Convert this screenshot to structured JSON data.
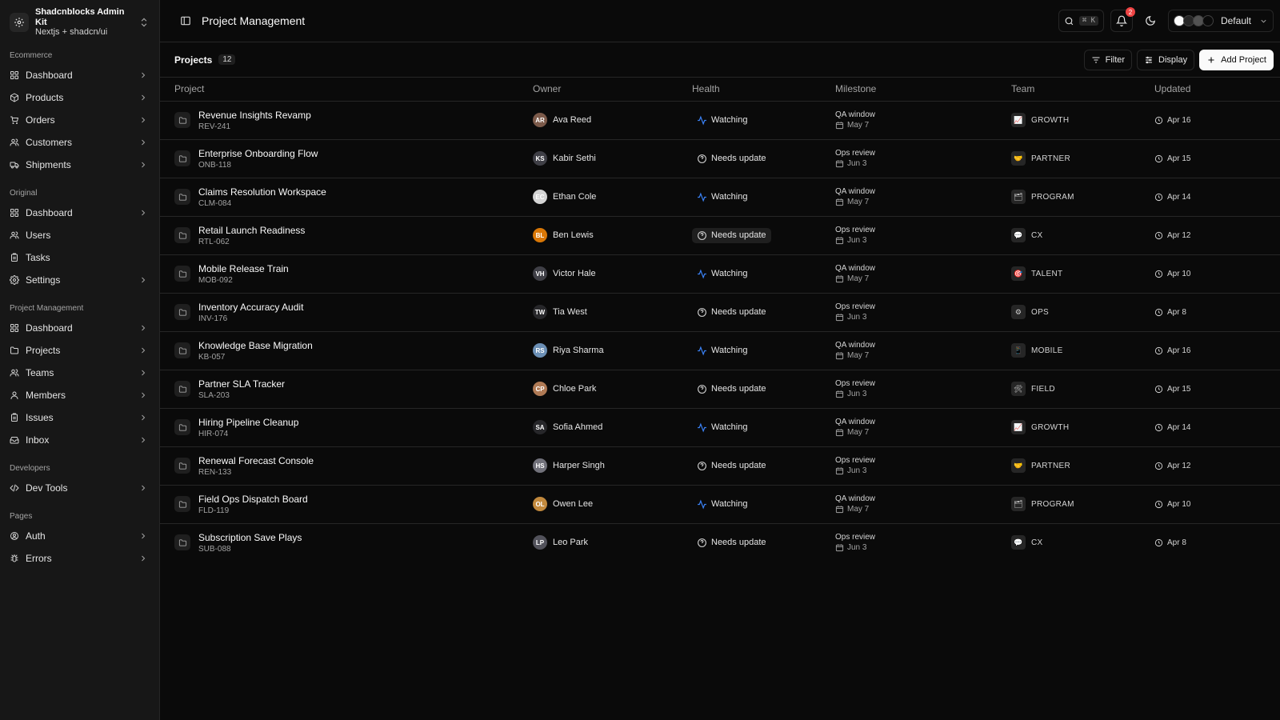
{
  "brand": {
    "name": "Shadcnblocks Admin Kit",
    "sub": "Nextjs + shadcn/ui"
  },
  "sidebar": {
    "groups": [
      {
        "label": "Ecommerce",
        "items": [
          {
            "label": "Dashboard",
            "icon": "dashboard-icon",
            "chevron": true
          },
          {
            "label": "Products",
            "icon": "package-icon",
            "chevron": true
          },
          {
            "label": "Orders",
            "icon": "cart-icon",
            "chevron": true
          },
          {
            "label": "Customers",
            "icon": "users-icon",
            "chevron": true
          },
          {
            "label": "Shipments",
            "icon": "truck-icon",
            "chevron": true
          }
        ]
      },
      {
        "label": "Original",
        "items": [
          {
            "label": "Dashboard",
            "icon": "dashboard-icon",
            "chevron": true
          },
          {
            "label": "Users",
            "icon": "users-icon",
            "chevron": false
          },
          {
            "label": "Tasks",
            "icon": "clipboard-icon",
            "chevron": false
          },
          {
            "label": "Settings",
            "icon": "gear-icon",
            "chevron": true
          }
        ]
      },
      {
        "label": "Project Management",
        "items": [
          {
            "label": "Dashboard",
            "icon": "dashboard-icon",
            "chevron": true
          },
          {
            "label": "Projects",
            "icon": "folder-icon",
            "chevron": true
          },
          {
            "label": "Teams",
            "icon": "users-icon",
            "chevron": true
          },
          {
            "label": "Members",
            "icon": "user-icon",
            "chevron": true
          },
          {
            "label": "Issues",
            "icon": "clipboard-icon",
            "chevron": true
          },
          {
            "label": "Inbox",
            "icon": "inbox-icon",
            "chevron": true
          }
        ]
      },
      {
        "label": "Developers",
        "items": [
          {
            "label": "Dev Tools",
            "icon": "code-icon",
            "chevron": true
          }
        ]
      },
      {
        "label": "Pages",
        "items": [
          {
            "label": "Auth",
            "icon": "auth-icon",
            "chevron": true
          },
          {
            "label": "Errors",
            "icon": "bug-icon",
            "chevron": true
          }
        ]
      }
    ]
  },
  "header": {
    "title": "Project Management",
    "search_kbd": "⌘ K",
    "notifications_count": "2",
    "theme_label": "Default"
  },
  "toolbar": {
    "title": "Projects",
    "count": "12",
    "filter_label": "Filter",
    "display_label": "Display",
    "add_label": "Add Project"
  },
  "columns": [
    "Project",
    "Owner",
    "Health",
    "Milestone",
    "Team",
    "Updated"
  ],
  "rows": [
    {
      "name": "Revenue Insights Revamp",
      "code": "REV-241",
      "owner": "Ava Reed",
      "avatar_color": "#7c5a4a",
      "health": "Watching",
      "milestone": "QA window",
      "due": "May 7",
      "team": "GROWTH",
      "team_icon": "📈",
      "updated": "Apr 16"
    },
    {
      "name": "Enterprise Onboarding Flow",
      "code": "ONB-118",
      "owner": "Kabir Sethi",
      "avatar_color": "#3f3f46",
      "health": "Needs update",
      "milestone": "Ops review",
      "due": "Jun 3",
      "team": "PARTNER",
      "team_icon": "🤝",
      "updated": "Apr 15"
    },
    {
      "name": "Claims Resolution Workspace",
      "code": "CLM-084",
      "owner": "Ethan Cole",
      "avatar_color": "#d4d4d4",
      "health": "Watching",
      "milestone": "QA window",
      "due": "May 7",
      "team": "PROGRAM",
      "team_icon": "🗂",
      "updated": "Apr 14"
    },
    {
      "name": "Retail Launch Readiness",
      "code": "RTL-062",
      "owner": "Ben Lewis",
      "avatar_color": "#d97706",
      "health": "Needs update",
      "milestone": "Ops review",
      "due": "Jun 3",
      "team": "CX",
      "team_icon": "💬",
      "updated": "Apr 12",
      "highlight": true
    },
    {
      "name": "Mobile Release Train",
      "code": "MOB-092",
      "owner": "Victor Hale",
      "avatar_color": "#3f3f46",
      "health": "Watching",
      "milestone": "QA window",
      "due": "May 7",
      "team": "TALENT",
      "team_icon": "🎯",
      "updated": "Apr 10"
    },
    {
      "name": "Inventory Accuracy Audit",
      "code": "INV-176",
      "owner": "Tia West",
      "avatar_color": "#27272a",
      "health": "Needs update",
      "milestone": "Ops review",
      "due": "Jun 3",
      "team": "OPS",
      "team_icon": "⚙",
      "updated": "Apr 8"
    },
    {
      "name": "Knowledge Base Migration",
      "code": "KB-057",
      "owner": "Riya Sharma",
      "avatar_color": "#6b8fb5",
      "health": "Watching",
      "milestone": "QA window",
      "due": "May 7",
      "team": "MOBILE",
      "team_icon": "📱",
      "updated": "Apr 16"
    },
    {
      "name": "Partner SLA Tracker",
      "code": "SLA-203",
      "owner": "Chloe Park",
      "avatar_color": "#b07a55",
      "health": "Needs update",
      "milestone": "Ops review",
      "due": "Jun 3",
      "team": "FIELD",
      "team_icon": "🛠",
      "updated": "Apr 15"
    },
    {
      "name": "Hiring Pipeline Cleanup",
      "code": "HIR-074",
      "owner": "Sofia Ahmed",
      "avatar_color": "#27272a",
      "health": "Watching",
      "milestone": "QA window",
      "due": "May 7",
      "team": "GROWTH",
      "team_icon": "📈",
      "updated": "Apr 14"
    },
    {
      "name": "Renewal Forecast Console",
      "code": "REN-133",
      "owner": "Harper Singh",
      "avatar_color": "#71717a",
      "health": "Needs update",
      "milestone": "Ops review",
      "due": "Jun 3",
      "team": "PARTNER",
      "team_icon": "🤝",
      "updated": "Apr 12"
    },
    {
      "name": "Field Ops Dispatch Board",
      "code": "FLD-119",
      "owner": "Owen Lee",
      "avatar_color": "#c2893d",
      "health": "Watching",
      "milestone": "QA window",
      "due": "May 7",
      "team": "PROGRAM",
      "team_icon": "🗂",
      "updated": "Apr 10"
    },
    {
      "name": "Subscription Save Plays",
      "code": "SUB-088",
      "owner": "Leo Park",
      "avatar_color": "#52525b",
      "health": "Needs update",
      "milestone": "Ops review",
      "due": "Jun 3",
      "team": "CX",
      "team_icon": "💬",
      "updated": "Apr 8"
    }
  ]
}
